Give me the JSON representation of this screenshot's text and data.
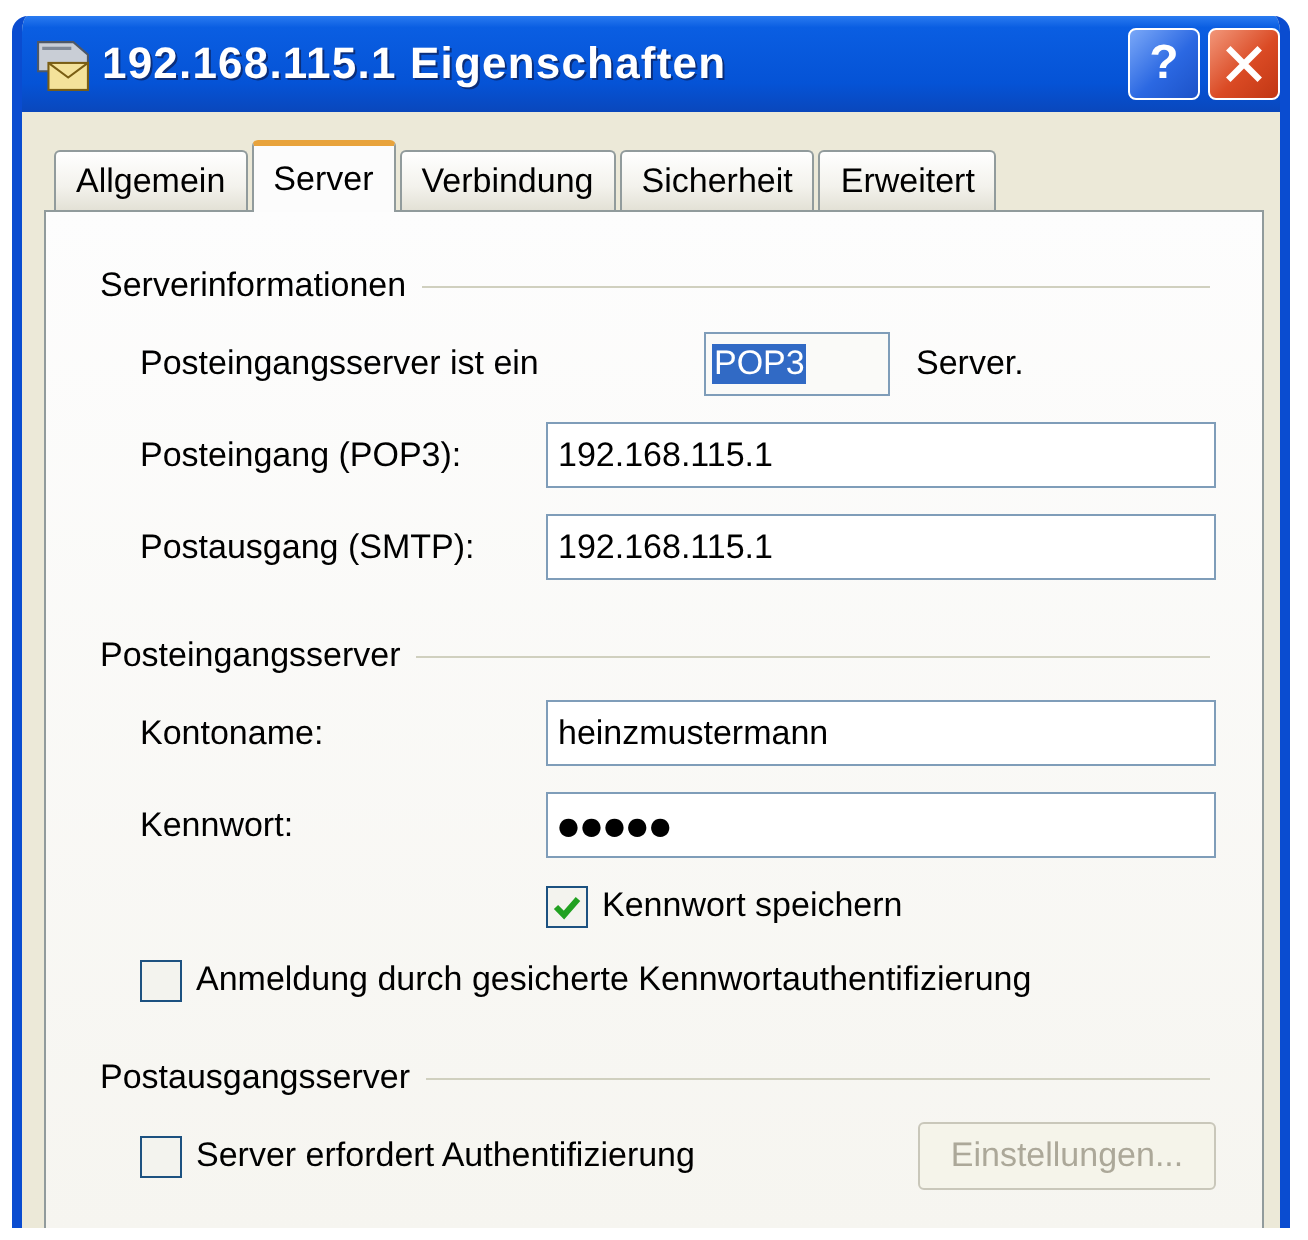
{
  "window": {
    "title": "192.168.115.1 Eigenschaften",
    "controls": [
      {
        "kind": "help",
        "label": "?"
      },
      {
        "kind": "close"
      }
    ]
  },
  "tabs": [
    {
      "label": "Allgemein",
      "selected": false
    },
    {
      "label": "Server",
      "selected": true
    },
    {
      "label": "Verbindung",
      "selected": false
    },
    {
      "label": "Sicherheit",
      "selected": false
    },
    {
      "label": "Erweitert",
      "selected": false
    }
  ],
  "groups": [
    {
      "title": "Serverinformationen",
      "rows": [
        {
          "kind": "type",
          "label": "Posteingangsserver ist ein",
          "value": "POP3",
          "highlighted": true,
          "suffix": "Server."
        },
        {
          "kind": "field",
          "label": "Posteingang (POP3):",
          "value": "192.168.115.1"
        },
        {
          "kind": "field",
          "label": "Postausgang (SMTP):",
          "value": "192.168.115.1"
        }
      ]
    },
    {
      "title": "Posteingangsserver",
      "rows": [
        {
          "kind": "field",
          "label": "Kontoname:",
          "value": "heinzmustermann"
        },
        {
          "kind": "password",
          "label": "Kennwort:",
          "value": "●●●●●",
          "checkbox": {
            "label": "Kennwort speichern",
            "checked": true
          }
        },
        {
          "kind": "checkbox",
          "label": "Anmeldung durch gesicherte Kennwortauthentifizierung",
          "checked": false
        }
      ]
    },
    {
      "title": "Postausgangsserver",
      "rows": [
        {
          "kind": "checkbox",
          "label": "Server erfordert Authentifizierung",
          "checked": false,
          "button": {
            "label": "Einstellungen...",
            "disabled": true
          }
        }
      ]
    }
  ]
}
